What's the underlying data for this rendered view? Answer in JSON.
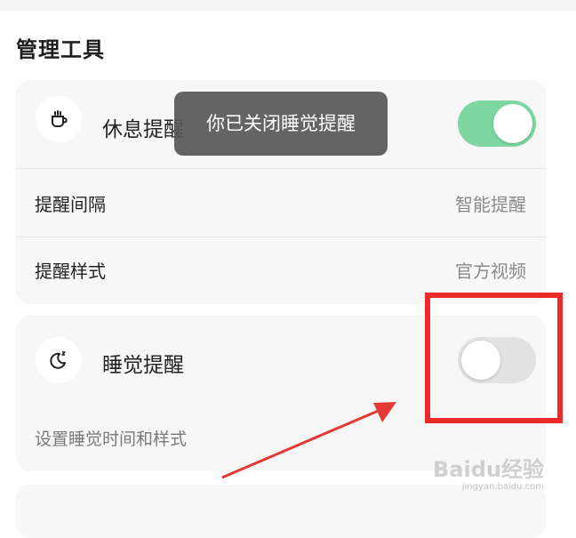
{
  "section": {
    "title": "管理工具"
  },
  "rest_reminder": {
    "title": "休息提醒",
    "icon": "cup-icon",
    "toggle_on": true,
    "interval_label": "提醒间隔",
    "interval_value": "智能提醒",
    "style_label": "提醒样式",
    "style_value": "官方视频"
  },
  "sleep_reminder": {
    "title": "睡觉提醒",
    "icon": "moon-sleep-icon",
    "toggle_on": false,
    "subtitle": "设置睡觉时间和样式"
  },
  "toast": {
    "message": "你已关闭睡觉提醒"
  },
  "annotation": {
    "box_color": "#ec2b2b",
    "arrow_color": "#e53935"
  },
  "colors": {
    "toggle_on": "#7ed6a0",
    "toggle_off": "#e2e2e2",
    "card_bg": "#f7f7f7"
  },
  "watermark": {
    "text": "Baidu经验",
    "url": "jingyan.baidu.com"
  }
}
